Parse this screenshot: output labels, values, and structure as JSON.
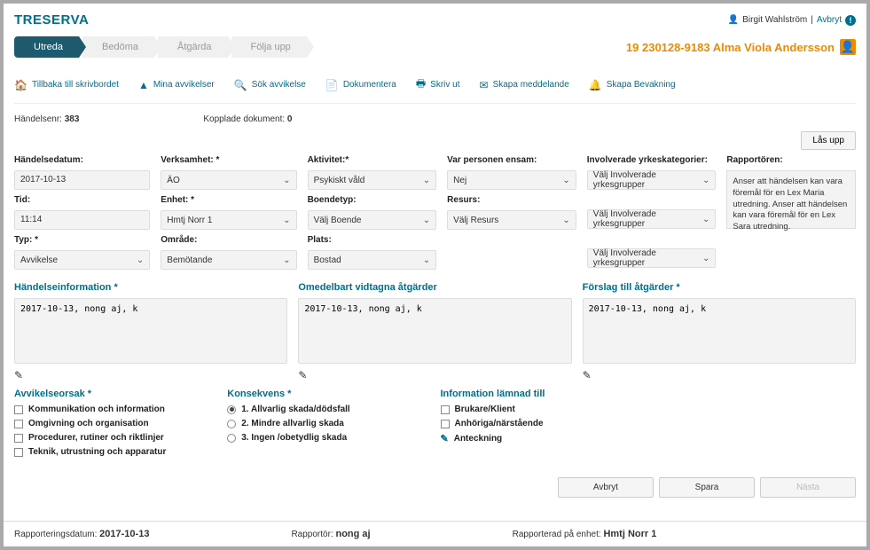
{
  "app_name": "TRESERVA",
  "user": {
    "name": "Birgit Wahlström",
    "cancel": "Avbryt"
  },
  "tabs": [
    "Utreda",
    "Bedöma",
    "Åtgärda",
    "Följa upp"
  ],
  "patient": "19 230128-9183 Alma Viola Andersson",
  "actions": {
    "home": "Tillbaka till skrivbordet",
    "mine": "Mina avvikelser",
    "search": "Sök avvikelse",
    "doc": "Dokumentera",
    "print": "Skriv ut",
    "msg": "Skapa meddelande",
    "watch": "Skapa Bevakning"
  },
  "meta": {
    "event_label": "Händelsenr:",
    "event_val": "383",
    "docs_label": "Kopplade dokument:",
    "docs_val": "0"
  },
  "lock_btn": "Lås upp",
  "labels": {
    "datum": "Händelsedatum:",
    "tid": "Tid:",
    "typ": "Typ: *",
    "verk": "Verksamhet: *",
    "enhet": "Enhet: *",
    "omrade": "Område:",
    "akt": "Aktivitet:*",
    "boende": "Boendetyp:",
    "plats": "Plats:",
    "ensam": "Var personen ensam:",
    "resurs": "Resurs:",
    "yrk": "Involverade yrkeskategorier:",
    "rapp": "Rapportören:"
  },
  "values": {
    "datum": "2017-10-13",
    "tid": "11:14",
    "typ": "Avvikelse",
    "verk": "ÄO",
    "enhet": "Hmtj Norr 1",
    "omrade": "Bemötande",
    "akt": "Psykiskt våld",
    "boende": "Välj Boende",
    "plats": "Bostad",
    "ensam": "Nej",
    "resurs": "Välj Resurs",
    "yrk": "Välj Involverade yrkesgrupper",
    "rapp": "Anser att händelsen kan vara föremål för en Lex Maria utredning.\n Anser att händelsen kan vara föremål för en Lex Sara utredning."
  },
  "sections": {
    "info_title": "Händelseinformation *",
    "atg_title": "Omedelbart vidtagna åtgärder",
    "forslag_title": "Förslag till åtgärder *",
    "text": "2017-10-13, nong aj, k"
  },
  "cause": {
    "title": "Avvikelseorsak  *",
    "items": [
      "Kommunikation och information",
      "Omgivning och organisation",
      "Procedurer, rutiner och riktlinjer",
      "Teknik, utrustning och apparatur"
    ]
  },
  "konsekvens": {
    "title": "Konsekvens  *",
    "items": [
      "1. Allvarlig skada/dödsfall",
      "2. Mindre allvarlig skada",
      "3. Ingen /obetydlig skada"
    ],
    "selected": 0
  },
  "info_lamnad": {
    "title": "Information lämnad till",
    "items": [
      "Brukare/Klient",
      "Anhöriga/närstående"
    ],
    "anteckning": "Anteckning"
  },
  "footer_btns": {
    "avbryt": "Avbryt",
    "spara": "Spara",
    "nasta": "Nästa"
  },
  "bottom": {
    "rep_label": "Rapporteringsdatum:",
    "rep_val": "2017-10-13",
    "rapportor_label": "Rapportör:",
    "rapportor_val": "nong aj",
    "enhet_label": "Rapporterad på enhet:",
    "enhet_val": "Hmtj Norr 1"
  }
}
